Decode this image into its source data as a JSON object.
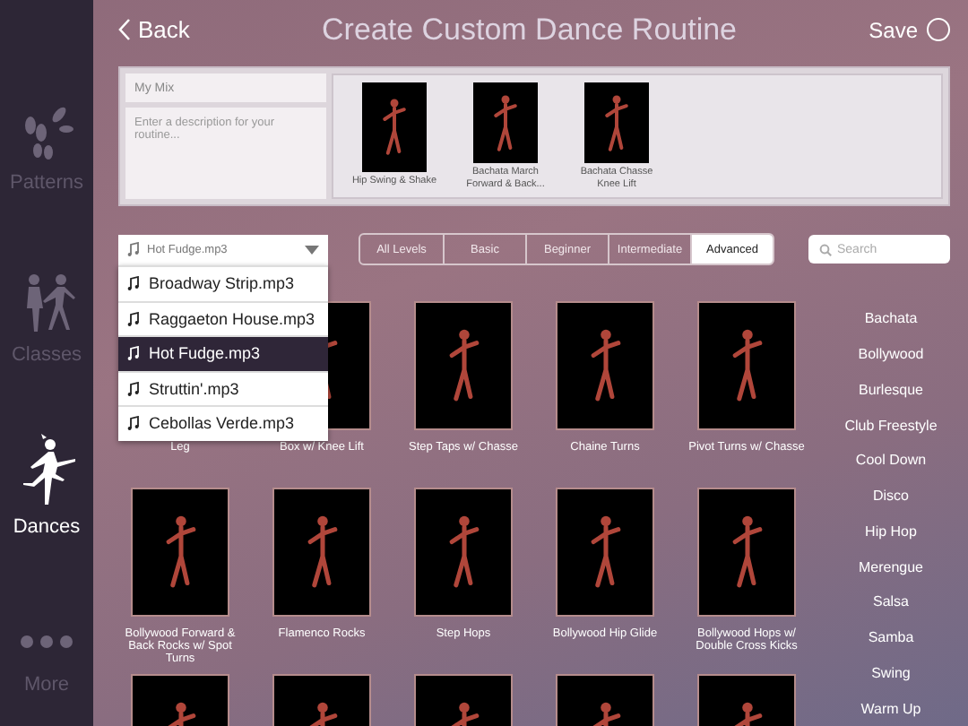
{
  "sidebar": {
    "items": [
      {
        "kind": "patterns",
        "label": "Patterns",
        "selected": false
      },
      {
        "kind": "classes",
        "label": "Classes",
        "selected": false
      },
      {
        "kind": "dances",
        "label": "Dances",
        "selected": true
      },
      {
        "kind": "more",
        "label": "More",
        "selected": false
      }
    ]
  },
  "header": {
    "back": "Back",
    "title": "Create Custom Dance Routine",
    "save": "Save"
  },
  "routine": {
    "name": "My Mix",
    "description_placeholder": "Enter a description for your routine...",
    "moves": [
      {
        "caption": "Hip Swing & Shake"
      },
      {
        "caption": "Bachata March Forward & Back..."
      },
      {
        "caption": "Bachata Chasse Knee Lift"
      }
    ]
  },
  "song_picker": {
    "value": "Hot Fudge.mp3",
    "expanded": true,
    "options": [
      {
        "label": "Broadway Strip.mp3",
        "selected": false
      },
      {
        "label": "Raggaeton House.mp3",
        "selected": false
      },
      {
        "label": "Hot Fudge.mp3",
        "selected": true
      },
      {
        "label": "Struttin'.mp3",
        "selected": false
      },
      {
        "label": "Cebollas Verde.mp3",
        "selected": false
      }
    ]
  },
  "levels": [
    {
      "label": "All Levels",
      "selected": false
    },
    {
      "label": "Basic",
      "selected": false
    },
    {
      "label": "Beginner",
      "selected": false
    },
    {
      "label": "Intermediate",
      "selected": false
    },
    {
      "label": "Advanced",
      "selected": true
    }
  ],
  "search": {
    "placeholder": "Search"
  },
  "moves": [
    {
      "kind": "captioned",
      "caption": "Leg"
    },
    {
      "kind": "captioned",
      "caption": "Box w/ Knee Lift"
    },
    {
      "kind": "captioned",
      "caption": "Step Taps w/ Chasse"
    },
    {
      "kind": "captioned",
      "caption": "Chaine Turns"
    },
    {
      "kind": "captioned",
      "caption": "Pivot Turns w/ Chasse"
    },
    {
      "kind": "captioned",
      "caption": "Bollywood Forward & Back Rocks w/ Spot Turns"
    },
    {
      "kind": "captioned",
      "caption": "Flamenco Rocks"
    },
    {
      "kind": "captioned",
      "caption": "Step Hops"
    },
    {
      "kind": "captioned",
      "caption": "Bollywood Hip Glide"
    },
    {
      "kind": "captioned",
      "caption": "Bollywood Hops w/ Double Cross Kicks"
    },
    {
      "kind": "cut_off"
    },
    {
      "kind": "cut_off"
    },
    {
      "kind": "cut_off"
    },
    {
      "kind": "cut_off"
    },
    {
      "kind": "cut_off"
    }
  ],
  "categories": [
    "Bachata",
    "Bollywood",
    "Burlesque",
    "Club Freestyle",
    "Cool Down",
    "Disco",
    "Hip Hop",
    "Merengue",
    "Salsa",
    "Samba",
    "Swing",
    "Warm Up"
  ]
}
